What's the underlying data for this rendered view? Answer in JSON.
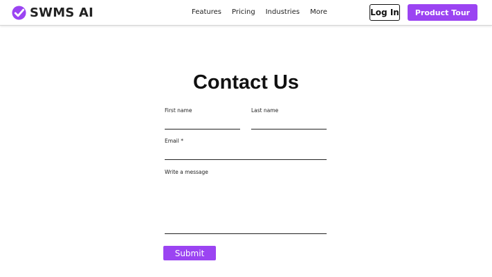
{
  "header": {
    "brand": "SWMS AI",
    "logo_icon": "check-badge-icon",
    "nav": [
      "Features",
      "Pricing",
      "Industries",
      "More"
    ],
    "login_label": "Log In",
    "tour_label": "Product Tour"
  },
  "colors": {
    "accent": "#9b44f2",
    "text": "#111111",
    "background": "#ffffff"
  },
  "form": {
    "title": "Contact Us",
    "first_name_label": "First name",
    "last_name_label": "Last name",
    "email_label": "Email *",
    "message_label": "Write a message",
    "submit_label": "Submit"
  }
}
